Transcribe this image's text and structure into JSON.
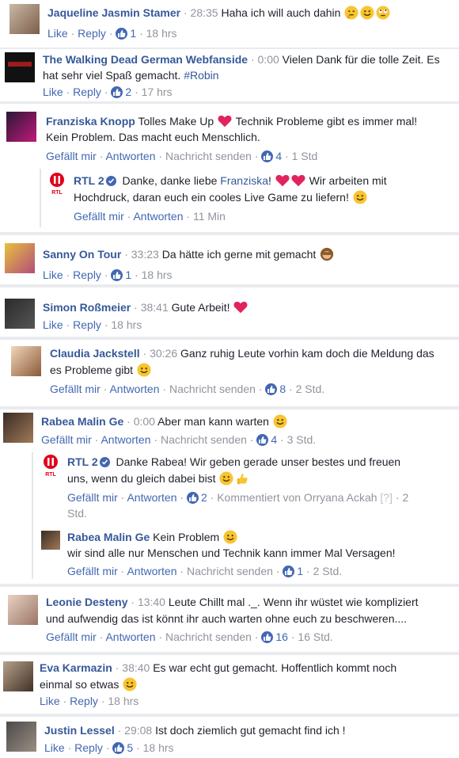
{
  "comments": [
    {
      "name": "Jaqueline Jasmin Stamer",
      "ts": "28:35",
      "text": "Haha ich will auch dahin",
      "like": "Like",
      "reply": "Reply",
      "count": "1",
      "age": "18 hrs"
    },
    {
      "name": "The Walking Dead German Webfanside",
      "ts": "0:00",
      "text1": "Vielen Dank für die tolle Zeit. Es",
      "text2a": "hat sehr viel Spaß gemacht.",
      "hashtag": "#Robin",
      "like": "Like",
      "reply": "Reply",
      "count": "2",
      "age": "17 hrs"
    },
    {
      "name": "Franziska Knopp",
      "text1a": "Tolles Make Up",
      "text1b": "Technik Probleme gibt es immer mal!",
      "text2": "Kein Problem. Das macht euch Menschlich.",
      "like": "Gefällt mir",
      "reply": "Antworten",
      "msg": "Nachricht senden",
      "count": "4",
      "age": "1 Std",
      "reply_item": {
        "name": "RTL 2",
        "text1a": "Danke, danke liebe",
        "mention": "Franziska",
        "text1b": "!",
        "text1c": "Wir arbeiten mit",
        "text2": "Hochdruck, daran euch ein cooles Live Game zu liefern!",
        "like": "Gefällt mir",
        "reply": "Antworten",
        "age": "11 Min",
        "logo": "RTL"
      }
    },
    {
      "name": "Sanny On Tour",
      "ts": "33:23",
      "text": "Da hätte ich gerne mit gemacht",
      "like": "Like",
      "reply": "Reply",
      "count": "1",
      "age": "18 hrs"
    },
    {
      "name": "Simon Roßmeier",
      "ts": "38:41",
      "text": "Gute Arbeit!",
      "like": "Like",
      "reply": "Reply",
      "age": "18 hrs"
    },
    {
      "name": "Claudia Jackstell",
      "ts": "30:26",
      "text1": "Ganz ruhig Leute vorhin kam doch die Meldung das",
      "text2": "es Probleme gibt",
      "like": "Gefällt mir",
      "reply": "Antworten",
      "msg": "Nachricht senden",
      "count": "8",
      "age": "2 Std."
    },
    {
      "name": "Rabea Malin Ge",
      "ts": "0:00",
      "text": "Aber man kann warten",
      "like": "Gefällt mir",
      "reply": "Antworten",
      "msg": "Nachricht senden",
      "count": "4",
      "age": "3 Std.",
      "reply1": {
        "name": "RTL 2",
        "text1": "Danke Rabea! Wir geben gerade unser bestes und freuen",
        "text2": "uns, wenn du gleich dabei bist",
        "like": "Gefällt mir",
        "reply": "Antworten",
        "count": "2",
        "commented": "Kommentiert von Orryana Ackah",
        "q": "[?]",
        "age1": "2",
        "age2": "Std.",
        "logo": "RTL"
      },
      "reply2": {
        "name": "Rabea Malin Ge",
        "text1": "Kein Problem",
        "text2": "wir sind alle nur Menschen und Technik kann immer Mal Versagen!",
        "like": "Gefällt mir",
        "reply": "Antworten",
        "msg": "Nachricht senden",
        "count": "1",
        "age": "2 Std."
      }
    },
    {
      "name": "Leonie Desteny",
      "ts": "13:40",
      "text1": "Leute Chillt mal ._. Wenn ihr wüstet wie kompliziert",
      "text2": "und aufwendig das ist könnt ihr auch warten ohne euch zu beschweren....",
      "like": "Gefällt mir",
      "reply": "Antworten",
      "msg": "Nachricht senden",
      "count": "16",
      "age": "16 Std."
    },
    {
      "name": "Eva Karmazin",
      "ts": "38:40",
      "text1": "Es war echt gut gemacht. Hoffentlich kommt noch",
      "text2": "einmal so etwas",
      "like": "Like",
      "reply": "Reply",
      "age": "18 hrs"
    },
    {
      "name": "Justin Lessel",
      "ts": "29:08",
      "text": "Ist doch ziemlich gut gemacht find ich !",
      "like": "Like",
      "reply": "Reply",
      "count": "5",
      "age": "18 hrs"
    }
  ],
  "sep": "·",
  "icons": {
    "like": "thumbs-up-icon",
    "heart": "heart-emoji-icon",
    "smile": "smile-emoji-icon",
    "verified": "verified-badge-icon"
  },
  "colors": {
    "link": "#365899",
    "action": "#4267b2",
    "muted": "#90949c",
    "like_badge": "#4267b2",
    "heart": "#e0245e",
    "emoji": "#f7c531"
  }
}
